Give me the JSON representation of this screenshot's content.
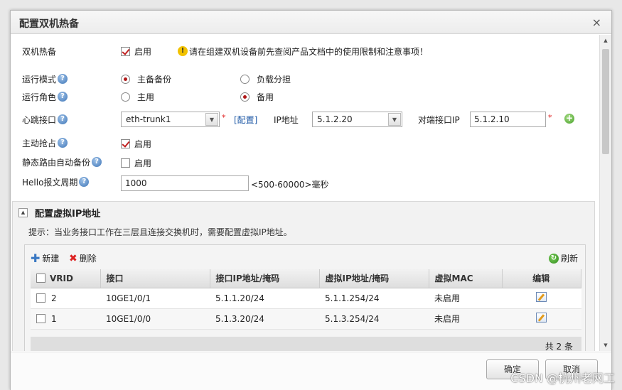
{
  "dialog": {
    "title": "配置双机热备",
    "close": "×"
  },
  "form": {
    "ha_label": "双机热备",
    "ha_enable": "启用",
    "warning": "请在组建双机设备前先查阅产品文档中的使用限制和注意事项！",
    "mode_label": "运行模式",
    "mode_options": [
      "主备备份",
      "负载分担"
    ],
    "role_label": "运行角色",
    "role_options": [
      "主用",
      "备用"
    ],
    "heartbeat_label": "心跳接口",
    "heartbeat_value": "eth-trunk1",
    "config_link": "[配置]",
    "ip_label": "IP地址",
    "ip_value": "5.1.2.20",
    "peer_label": "对端接口IP",
    "peer_value": "5.1.2.10",
    "preempt_label": "主动抢占",
    "preempt_enable": "启用",
    "static_route_label": "静态路由自动备份",
    "static_route_enable": "启用",
    "hello_label": "Hello报文周期",
    "hello_value": "1000",
    "hello_range": "<500-60000>毫秒",
    "required_mark": "*"
  },
  "vip_panel": {
    "title": "配置虚拟IP地址",
    "hint": "提示：当业务接口工作在三层且连接交换机时，需要配置虚拟IP地址。",
    "toolbar": {
      "new": "新建",
      "delete": "删除",
      "refresh": "刷新"
    },
    "columns": [
      "VRID",
      "接口",
      "接口IP地址/掩码",
      "虚拟IP地址/掩码",
      "虚拟MAC",
      "编辑"
    ],
    "rows": [
      {
        "vrid": "2",
        "iface": "10GE1/0/1",
        "iface_ip": "5.1.1.20/24",
        "vip": "5.1.1.254/24",
        "vmac": "未启用"
      },
      {
        "vrid": "1",
        "iface": "10GE1/0/0",
        "iface_ip": "5.1.3.20/24",
        "vip": "5.1.3.254/24",
        "vmac": "未启用"
      }
    ],
    "total": "共 2 条"
  },
  "buttons": {
    "ok": "确定",
    "cancel": "取消"
  },
  "watermark": "CSDN @杭州老网工",
  "colors": {
    "accent": "#1c57a5",
    "required": "#e02020",
    "check": "#c02020"
  }
}
